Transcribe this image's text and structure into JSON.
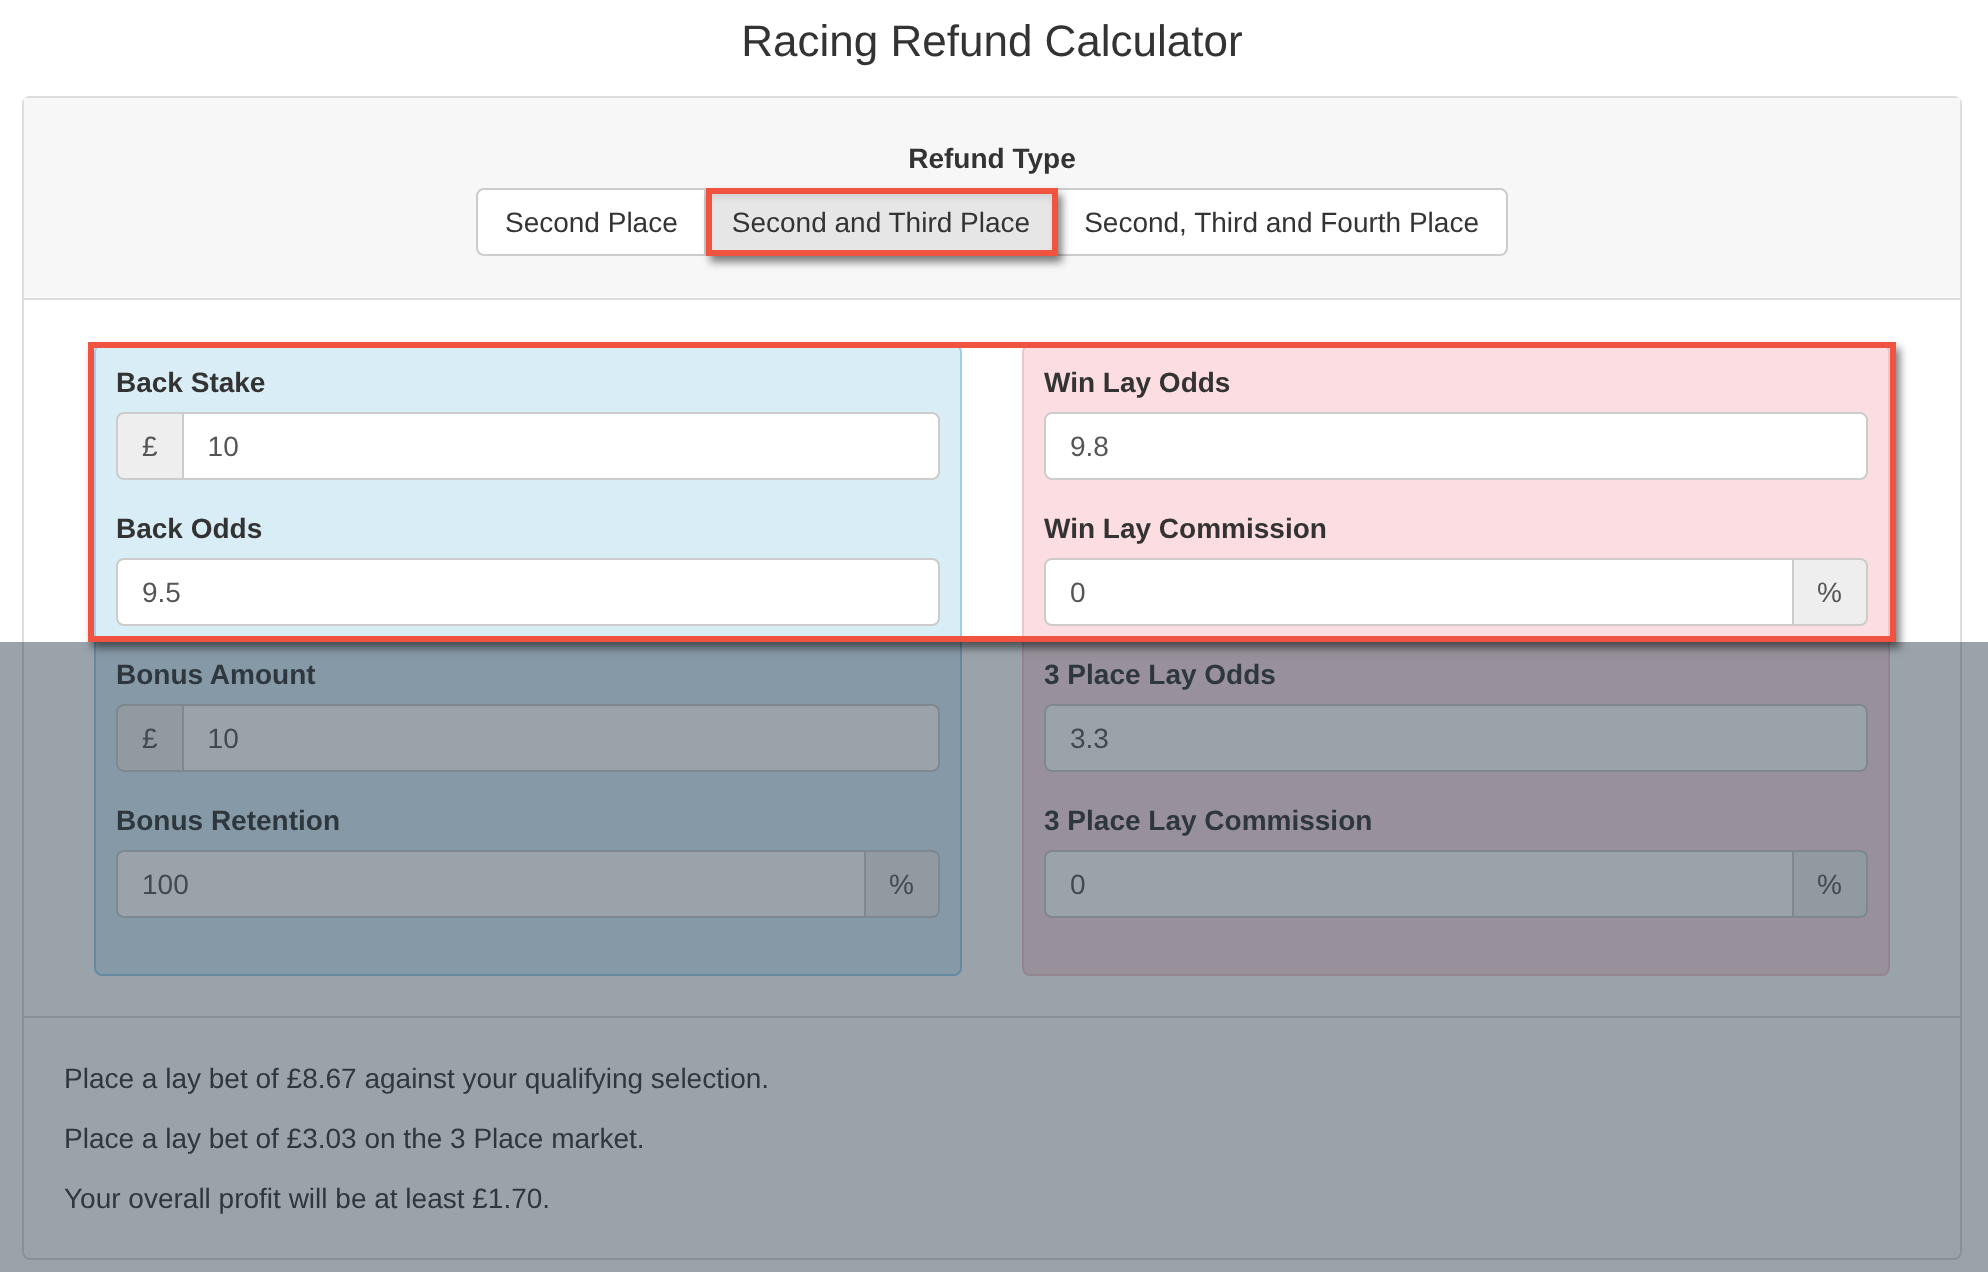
{
  "title": "Racing Refund Calculator",
  "refund_type": {
    "label": "Refund Type",
    "options": [
      {
        "label": "Second Place",
        "selected": false,
        "highlighted": false
      },
      {
        "label": "Second and Third Place",
        "selected": true,
        "highlighted": true
      },
      {
        "label": "Second, Third and Fourth Place",
        "selected": false,
        "highlighted": false
      }
    ]
  },
  "panels": [
    {
      "kind": "back",
      "fields": [
        {
          "label": "Back Stake",
          "kind": "prefix",
          "addon": "£",
          "value": "10",
          "highlighted": true
        },
        {
          "label": "Back Odds",
          "kind": "plain",
          "value": "9.5",
          "highlighted": true
        },
        {
          "label": "Bonus Amount",
          "kind": "prefix",
          "addon": "£",
          "value": "10",
          "highlighted": false
        },
        {
          "label": "Bonus Retention",
          "kind": "suffix",
          "addon": "%",
          "value": "100",
          "highlighted": false
        }
      ]
    },
    {
      "kind": "lay",
      "fields": [
        {
          "label": "Win Lay Odds",
          "kind": "plain",
          "value": "9.8",
          "highlighted": true
        },
        {
          "label": "Win Lay Commission",
          "kind": "suffix",
          "addon": "%",
          "value": "0",
          "highlighted": true
        },
        {
          "label": "3 Place Lay Odds",
          "kind": "plain",
          "value": "3.3",
          "highlighted": false
        },
        {
          "label": "3 Place Lay Commission",
          "kind": "suffix",
          "addon": "%",
          "value": "0",
          "highlighted": false
        }
      ]
    }
  ],
  "results": [
    "Place a lay bet of £8.67 against your qualifying selection.",
    "Place a lay bet of £3.03 on the 3 Place market.",
    "Your overall profit will be at least £1.70."
  ]
}
